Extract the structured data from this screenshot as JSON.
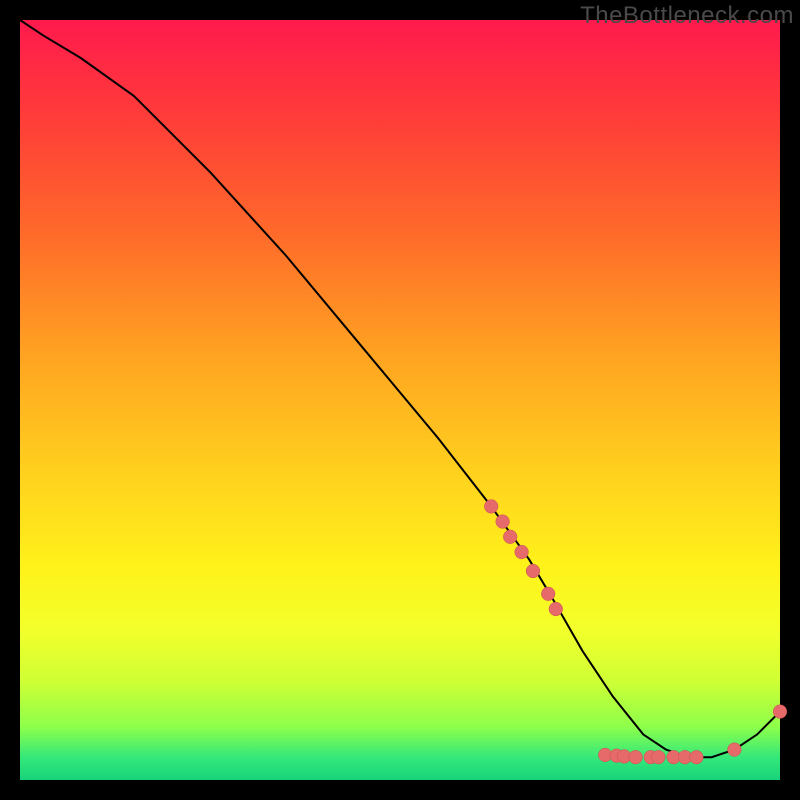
{
  "watermark": "TheBottleneck.com",
  "chart_data": {
    "type": "line",
    "title": "",
    "xlabel": "",
    "ylabel": "",
    "xlim": [
      0,
      100
    ],
    "ylim": [
      0,
      100
    ],
    "grid": false,
    "legend": false,
    "series": [
      {
        "name": "curve",
        "x": [
          0,
          3,
          8,
          15,
          25,
          35,
          45,
          55,
          62,
          67,
          70,
          74,
          78,
          82,
          85,
          88,
          91,
          94,
          97,
          100
        ],
        "y": [
          100,
          98,
          95,
          90,
          80,
          69,
          57,
          45,
          36,
          29,
          24,
          17,
          11,
          6,
          4,
          3,
          3,
          4,
          6,
          9
        ]
      }
    ],
    "markers": [
      {
        "x": 62.0,
        "y": 36.0
      },
      {
        "x": 63.5,
        "y": 34.0
      },
      {
        "x": 64.5,
        "y": 32.0
      },
      {
        "x": 66.0,
        "y": 30.0
      },
      {
        "x": 67.5,
        "y": 27.5
      },
      {
        "x": 69.5,
        "y": 24.5
      },
      {
        "x": 70.5,
        "y": 22.5
      },
      {
        "x": 77.0,
        "y": 3.3
      },
      {
        "x": 78.5,
        "y": 3.2
      },
      {
        "x": 79.5,
        "y": 3.1
      },
      {
        "x": 81.0,
        "y": 3.0
      },
      {
        "x": 83.0,
        "y": 3.0
      },
      {
        "x": 84.0,
        "y": 3.0
      },
      {
        "x": 86.0,
        "y": 3.0
      },
      {
        "x": 87.5,
        "y": 3.0
      },
      {
        "x": 89.0,
        "y": 3.0
      },
      {
        "x": 94.0,
        "y": 4.0
      },
      {
        "x": 100.0,
        "y": 9.0
      }
    ],
    "colors": {
      "curve": "#000000",
      "marker_fill": "#e66a6a",
      "marker_stroke": "#c94f4f"
    }
  }
}
